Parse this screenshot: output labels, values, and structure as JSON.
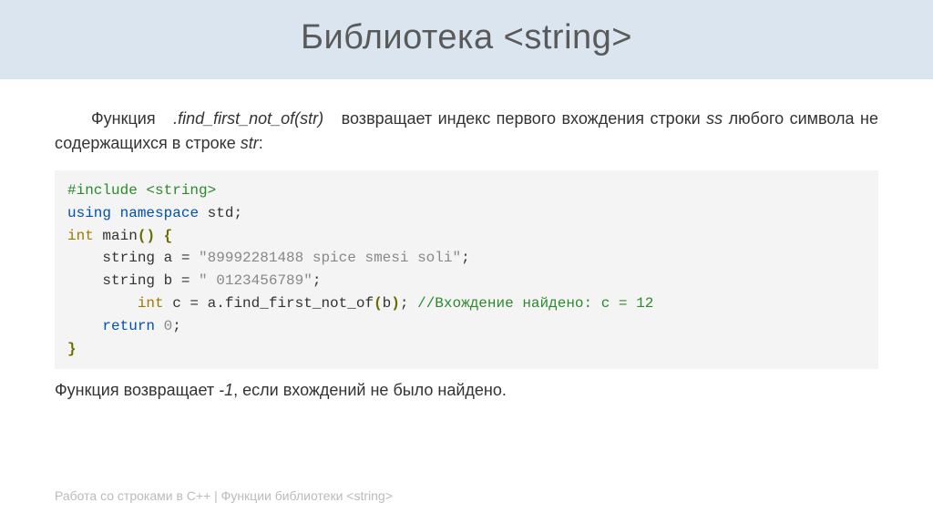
{
  "header": {
    "title": "Библиотека <string>"
  },
  "intro": {
    "prefix": "Функция",
    "func": ".find_first_not_of(str)",
    "middle": "возвращает индекс первого вхождения строки",
    "ss": "ss",
    "middle2": "любого символа не содержащихся в строке",
    "str": "str",
    "end": ":"
  },
  "code": {
    "l1a": "#include",
    "l1b": "<string>",
    "l2a": "using",
    "l2b": "namespace",
    "l2c": "std;",
    "l3a": "int",
    "l3b": "main",
    "l3c": "(",
    "l3d": ")",
    "l3e": " {",
    "l4a": "    string a = ",
    "l4b": "\"89992281488 spice smesi soli\"",
    "l4c": ";",
    "l5a": "    string b = ",
    "l5b": "\" 0123456789\"",
    "l5c": ";",
    "l6a": "        ",
    "l6b": "int",
    "l6c": " c = a.find_first_not_of",
    "l6d": "(",
    "l6e": "b",
    "l6f": ")",
    "l6g": "; ",
    "l6h": "//Вхождение найдено: c = 12",
    "l7a": "    ",
    "l7b": "return",
    "l7c": " ",
    "l7d": "0",
    "l7e": ";",
    "l8": "}"
  },
  "after": {
    "prefix": "Функция возвращает",
    "val": "-1",
    "suffix": ", если вхождений не было найдено."
  },
  "footer": {
    "left": "Работа со строками в C++",
    "sep": " | ",
    "right": "Функции библиотеки <string>"
  }
}
